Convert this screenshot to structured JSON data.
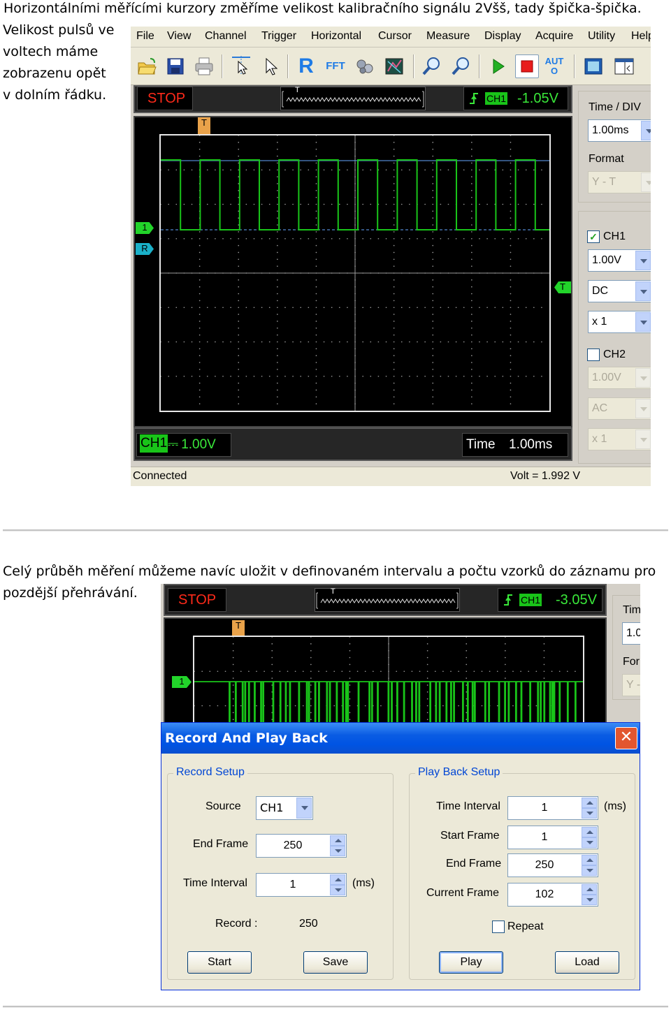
{
  "text": {
    "para1": "Horizontálními měřícími kurzory změříme velikost kalibračního signálu 2Všš, tady špička-špička.",
    "para1_cont": [
      "Velikost pulsů ve",
      "voltech máme",
      "zobrazenu opět",
      "v dolním řádku."
    ],
    "para2": "Celý průběh měření můžeme navíc uložit v definovaném intervalu a počtu vzorků do záznamu pro",
    "para2_cont": "pozdější přehrávání."
  },
  "scope1": {
    "menu": [
      "File",
      "View",
      "Channel",
      "Trigger",
      "Horizontal",
      "Cursor",
      "Measure",
      "Display",
      "Acquire",
      "Utility",
      "Help"
    ],
    "toolbar": {
      "open": "folder-open-icon",
      "save": "save-icon",
      "print": "print-icon",
      "cursor_cross": "cursor-crosshair-icon",
      "pointer": "pointer-icon",
      "ref": "R",
      "fft": "FFT",
      "math": "math-icon",
      "display": "display-icon",
      "zoom_in": "zoom-in-icon",
      "zoom_out": "zoom-out-icon",
      "run": "run-icon",
      "stop": "stop-icon",
      "auto": "AUTO",
      "capture": "capture-icon",
      "window": "window-icon"
    },
    "status": "STOP",
    "trigger": {
      "channel": "CH1",
      "level": "-1.05V",
      "marker": "T"
    },
    "markers": {
      "ch1": "1",
      "ref": "R",
      "trigger_level": "T",
      "trigger_pos": "T"
    },
    "bottom_ch": {
      "channel": "CH1",
      "coupling_glyph": "⎓",
      "scale": "1.00V"
    },
    "bottom_time": {
      "label": "Time",
      "value": "1.00ms"
    },
    "panel": {
      "time_div_label": "Time / DIV",
      "time_div_value": "1.00ms",
      "format_label": "Format",
      "format_value": "Y - T",
      "ch1_label": "CH1",
      "ch1_checked": true,
      "ch1_volt": "1.00V",
      "ch1_coupling": "DC",
      "ch1_probe": "x 1",
      "ch2_label": "CH2",
      "ch2_checked": false,
      "ch2_volt": "1.00V",
      "ch2_coupling": "AC",
      "ch2_probe": "x 1"
    },
    "statusbar": {
      "left": "Connected",
      "right": "Volt = 1.992 V"
    },
    "colors": {
      "trace": "#19c419",
      "cursor": "#66a8ff",
      "stop": "#ff2a1a",
      "ref": "#1ab0c8"
    }
  },
  "scope2": {
    "status": "STOP",
    "trigger": {
      "channel": "CH1",
      "level": "-3.05V",
      "marker": "T"
    },
    "markers": {
      "ch1": "1",
      "trigger_pos": "T"
    },
    "panel": {
      "time_label": "Tim",
      "time_value": "1.0",
      "format_label": "For",
      "format_value": "Y -"
    }
  },
  "dialog": {
    "title": "Record And Play Back",
    "record": {
      "legend": "Record Setup",
      "source_label": "Source",
      "source_value": "CH1",
      "end_frame_label": "End Frame",
      "end_frame_value": "250",
      "interval_label": "Time Interval",
      "interval_value": "1",
      "interval_unit": "(ms)",
      "record_label": "Record :",
      "record_value": "250",
      "start_label": "Start",
      "save_label": "Save"
    },
    "playback": {
      "legend": "Play Back Setup",
      "interval_label": "Time Interval",
      "interval_value": "1",
      "interval_unit": "(ms)",
      "start_frame_label": "Start Frame",
      "start_frame_value": "1",
      "end_frame_label": "End Frame",
      "end_frame_value": "250",
      "current_frame_label": "Current Frame",
      "current_frame_value": "102",
      "repeat_label": "Repeat",
      "repeat_checked": false,
      "play_label": "Play",
      "load_label": "Load"
    }
  }
}
